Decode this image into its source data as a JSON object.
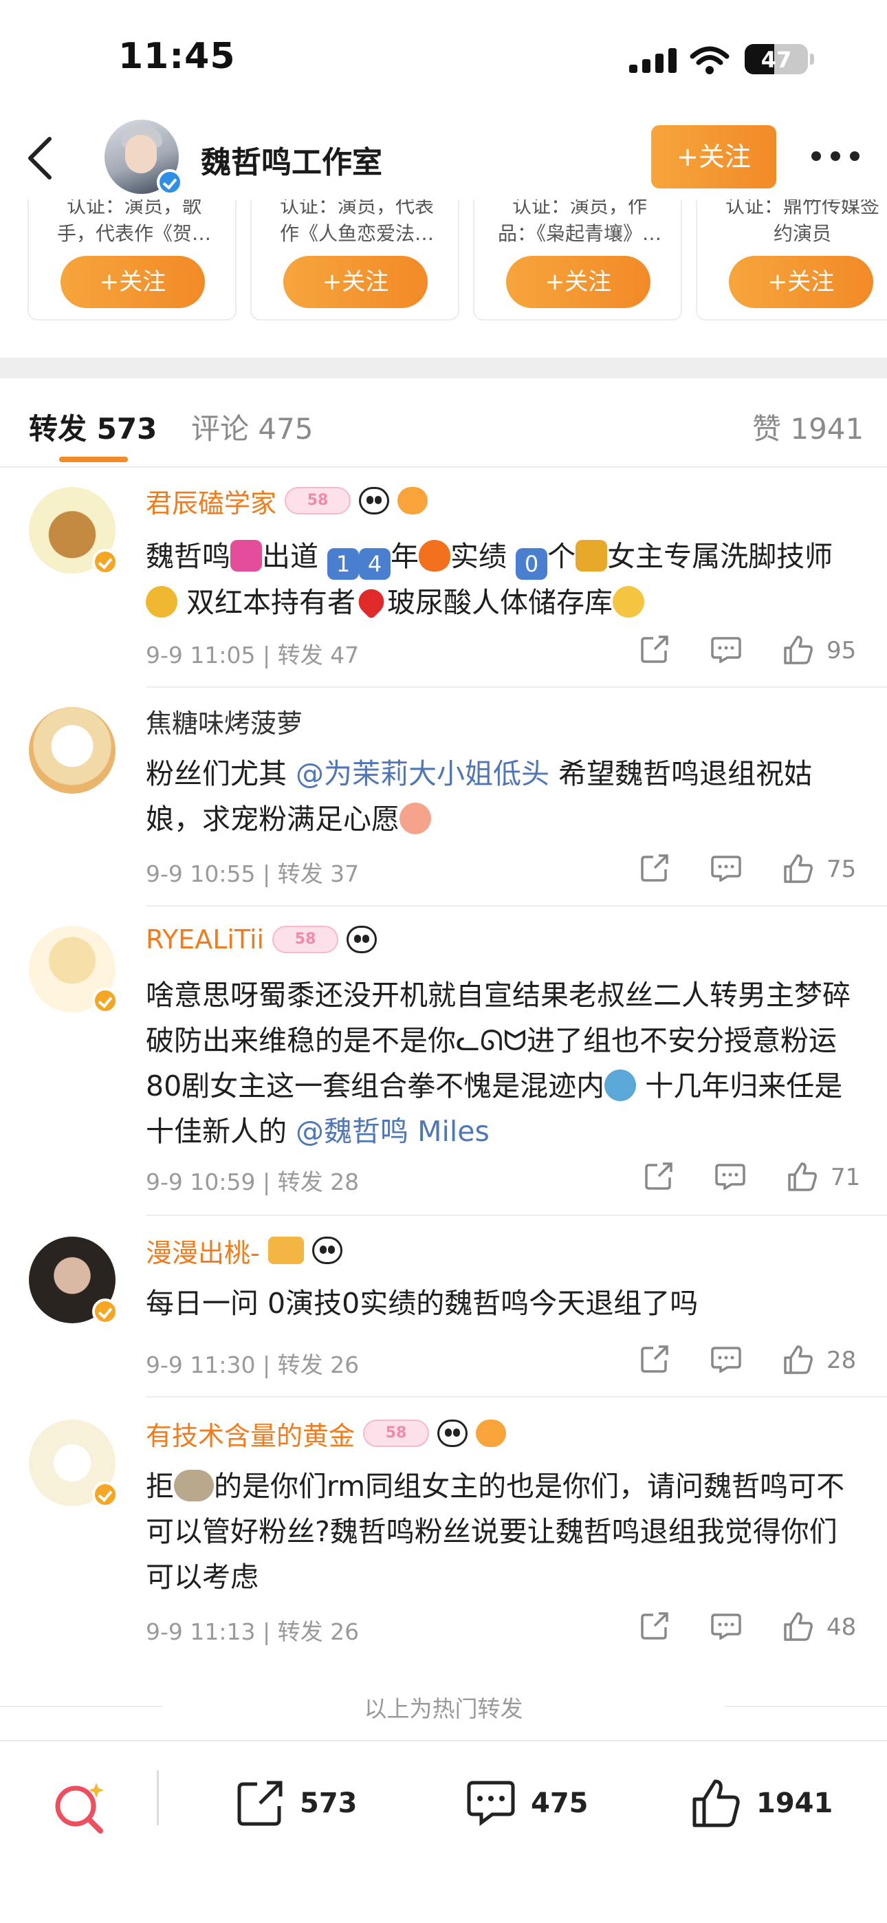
{
  "status": {
    "time": "11:45",
    "battery": "47",
    "battery_level": 0.47
  },
  "header": {
    "title": "魏哲鸣工作室",
    "follow_label": "+关注"
  },
  "cards": [
    {
      "line1": "认证：演员，歌",
      "line2": "手，代表作《贺…",
      "follow": "+关注"
    },
    {
      "line1": "认证：演员，代表",
      "line2": "作《人鱼恋爱法…",
      "follow": "+关注"
    },
    {
      "line1": "认证：演员，作",
      "line2": "品：《枭起青壤》…",
      "follow": "+关注"
    },
    {
      "line1": "认证：鼎竹传媒签",
      "line2": "约演员",
      "follow": "+关注"
    }
  ],
  "tabs": {
    "reposts": "转发 573",
    "comments": "评论 475",
    "likes": "赞 1941"
  },
  "comments": [
    {
      "user": "君辰磕学家",
      "medal": "58",
      "text_parts": [
        "魏哲鸣",
        "出道",
        "1",
        "4",
        "年",
        "实绩",
        "0",
        "个",
        "女主专属洗脚技师",
        " 双红本持有者",
        "玻尿酸人体储存库"
      ],
      "time": "9-9 11:05",
      "repost": "转发 47",
      "likes": "95"
    },
    {
      "user": "焦糖味烤菠萝",
      "text_a": "粉丝们尤其 ",
      "mention": "@为茉莉大小姐低头",
      "text_b": " 希望魏哲鸣退组祝姑娘，求宠粉满足心愿",
      "time": "9-9 10:55",
      "repost": "转发 37",
      "likes": "75"
    },
    {
      "user": "RYEALiTii",
      "medal": "58",
      "text_a": "啥意思呀蜀黍还没开机就自宣结果老叔丝二人转男主梦碎破防出来维稳的是不是你ᓚᘏᗢ进了组也不安分授意粉运80剧女主这一套组合拳不愧是混迹内",
      "text_b": "十几年归来任是十佳新人的 ",
      "mention": "@魏哲鸣 Miles",
      "time": "9-9 10:59",
      "repost": "转发 28",
      "likes": "71"
    },
    {
      "user": "漫漫出桃-",
      "text": "每日一问 0演技0实绩的魏哲鸣今天退组了吗",
      "time": "9-9 11:30",
      "repost": "转发 26",
      "likes": "28"
    },
    {
      "user": "有技术含量的黄金",
      "medal": "58",
      "text_a": "拒",
      "text_b": "的是你们rm同组女主的也是你们，请问魏哲鸣可不可以管好粉丝?魏哲鸣粉丝说要让魏哲鸣退组我觉得你们可以考虑",
      "time": "9-9 11:13",
      "repost": "转发 26",
      "likes": "48"
    }
  ],
  "footer_note": "以上为热门转发",
  "bottom": {
    "reposts": "573",
    "comments": "475",
    "likes": "1941"
  },
  "colors": {
    "accent": "#f28a27",
    "mention": "#4f76b5",
    "username": "#f07c1e"
  }
}
